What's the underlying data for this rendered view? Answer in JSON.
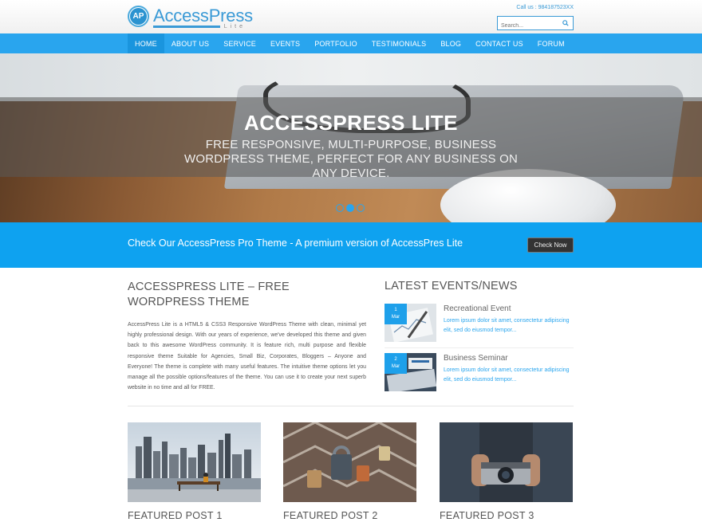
{
  "header": {
    "logo_badge": "AP",
    "logo_name": "AccessPress",
    "logo_sub": "Lite",
    "call": "Call us : 984187523XX",
    "search_placeholder": "Search..."
  },
  "nav": {
    "items": [
      {
        "label": "HOME"
      },
      {
        "label": "ABOUT US"
      },
      {
        "label": "SERVICE"
      },
      {
        "label": "EVENTS"
      },
      {
        "label": "PORTFOLIO"
      },
      {
        "label": "TESTIMONIALS"
      },
      {
        "label": "BLOG"
      },
      {
        "label": "CONTACT US"
      },
      {
        "label": "FORUM"
      }
    ],
    "active": "HOME"
  },
  "hero": {
    "title": "ACCESSPRESS LITE",
    "caption": "FREE RESPONSIVE, MULTI-PURPOSE, BUSINESS WORDPRESS THEME, PERFECT FOR ANY BUSINESS ON ANY DEVICE.",
    "slides": 3,
    "active_slide": 2
  },
  "promo": {
    "text": "Check Our AccessPress Pro Theme - A premium version of AccessPres Lite",
    "button": "Check Now"
  },
  "about": {
    "title": "ACCESSPRESS LITE – FREE WORDPRESS THEME",
    "body": "AccessPress Lite is a HTML5 & CSS3 Responsive WordPress Theme with clean, minimal yet highly professional design. With our years of experience, we've developed this theme and given back to this awesome WordPress community. It is feature rich, multi purpose and flexible responsive theme Suitable for Agencies, Small Biz, Corporates, Bloggers – Anyone and Everyone! The theme is complete with many useful features. The intuitive theme options let you manage all the possible options/features of the theme. You can use it to create your next superb website in no time and all for FREE."
  },
  "events": {
    "title": "LATEST EVENTS/NEWS",
    "items": [
      {
        "day": "1",
        "month": "Mar",
        "title": "Recreational Event",
        "desc": "Lorem ipsum dolor sit amet, consectetur adipiscing elit, sed do eiusmod tempor..."
      },
      {
        "day": "2",
        "month": "Mar",
        "title": "Business Seminar",
        "desc": "Lorem ipsum dolor sit amet, consectetur adipiscing elit, sed do eiusmod tempor..."
      }
    ]
  },
  "featured": [
    {
      "title": "FEATURED POST 1"
    },
    {
      "title": "FEATURED POST 2"
    },
    {
      "title": "FEATURED POST 3"
    }
  ],
  "colors": {
    "primary": "#29a5ee",
    "promo": "#0ea2f0",
    "logo": "#3a9ad6"
  }
}
